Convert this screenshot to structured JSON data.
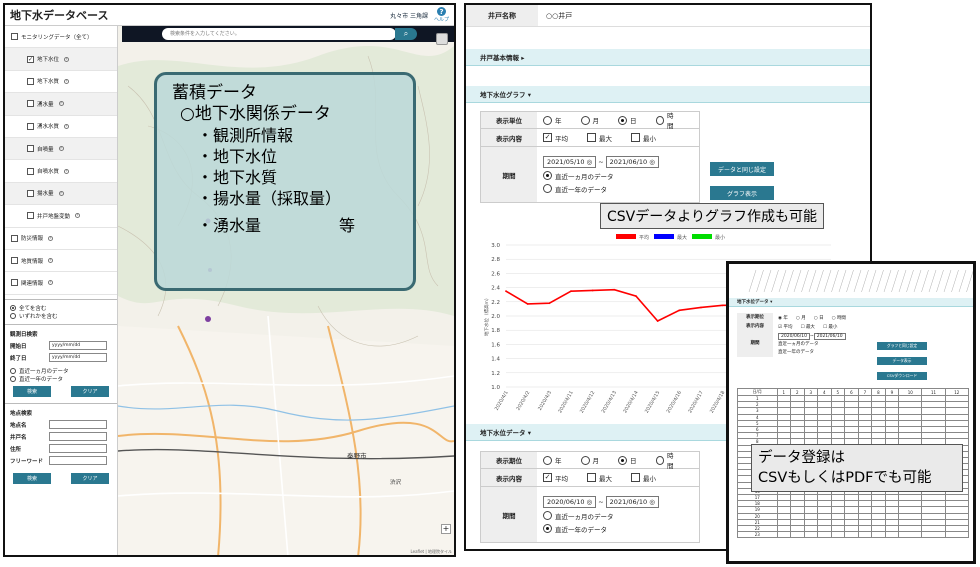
{
  "app": {
    "title": "地下水データベース",
    "department": "丸々市 三角課",
    "help_label": "ヘルプ",
    "help_glyph": "?"
  },
  "sidebar": {
    "monitoring_all": "モニタリングデータ（全て）",
    "monitoring_items": [
      {
        "label": "地下水位",
        "checked": true
      },
      {
        "label": "地下水質",
        "checked": false
      },
      {
        "label": "湧水量",
        "checked": false
      },
      {
        "label": "湧水水質",
        "checked": false
      },
      {
        "label": "自噴量",
        "checked": false
      },
      {
        "label": "自噴水質",
        "checked": false
      },
      {
        "label": "揚水量",
        "checked": false
      },
      {
        "label": "井戸地盤変動",
        "checked": false
      }
    ],
    "other_items": [
      {
        "label": "防災情報"
      },
      {
        "label": "地質情報"
      },
      {
        "label": "関連情報"
      }
    ],
    "match_all": "全てを含む",
    "match_any": "いずれかを含む",
    "obs_date": {
      "heading": "観測日検索",
      "start_label": "開始日",
      "end_label": "終了日",
      "date_placeholder": "yyyy/mm/dd",
      "recent_month": "直近一ヵ月のデータ",
      "recent_year": "直近一年のデータ",
      "search_btn": "検索",
      "clear_btn": "クリア"
    },
    "site_search": {
      "heading": "地点検索",
      "fields": [
        "地点名",
        "井戸名",
        "住所",
        "フリーワード"
      ],
      "search_btn": "検索",
      "clear_btn": "クリア"
    }
  },
  "map": {
    "search_placeholder": "検索条件を入力してください。",
    "search_icon": "magnifier-icon",
    "overlay": {
      "title": "蓄積データ",
      "subtitle": "○地下水関係データ",
      "items": [
        "・観測所情報",
        "・地下水位",
        "・地下水質",
        "・揚水量（採取量）"
      ],
      "last_item": "・湧水量",
      "last_suffix": "等"
    },
    "labels": {
      "hadano": "秦野市",
      "suginome": "渋沢",
      "attribution": "Leaflet | 地理院タイル"
    },
    "zoom_in": "+"
  },
  "well": {
    "name_label": "井戸名称",
    "name_value": "○○井戸",
    "basic_info_section": "井戸基本情報 ▸",
    "graph_section": "地下水位グラフ ▾",
    "display_unit_label": "表示単位",
    "units": [
      {
        "label": "年",
        "on": false
      },
      {
        "label": "月",
        "on": false
      },
      {
        "label": "日",
        "on": true
      },
      {
        "label": "時間",
        "on": false
      }
    ],
    "display_content_label": "表示内容",
    "contents": [
      {
        "label": "平均",
        "checked": true
      },
      {
        "label": "最大",
        "checked": false
      },
      {
        "label": "最小",
        "checked": false
      }
    ],
    "period_label": "期間",
    "graph_from": "2021/05/10",
    "graph_to": "2021/06/10",
    "recent_month": "直近一ヵ月のデータ",
    "recent_year": "直近一年のデータ",
    "same_as_data_btn": "データと同じ設定",
    "show_graph_btn": "グラフ表示",
    "data_section": "地下水位データ ▾",
    "display_interval_label": "表示期位",
    "data_from": "2020/06/10",
    "data_to": "2021/06/10",
    "callout_graph": "CSVデータよりグラフ作成も可能",
    "callout_csv_line1": "データ登録は",
    "callout_csv_line2": "CSVもしくはPDFでも可能"
  },
  "chart_data": {
    "type": "line",
    "title": "地下水位",
    "ylabel": "地下水位（標高m）",
    "ylim": [
      1.0,
      3.0
    ],
    "yticks": [
      1.0,
      1.2,
      1.4,
      1.6,
      1.8,
      2.0,
      2.2,
      2.4,
      2.6,
      2.8,
      3.0
    ],
    "legend": [
      {
        "name": "平均",
        "color": "#ff0000"
      },
      {
        "name": "最大",
        "color": "#0000ff"
      },
      {
        "name": "最小",
        "color": "#00dd00"
      }
    ],
    "x": [
      "2020/4/1",
      "2020/4/2",
      "2020/4/3",
      "2020/4/11",
      "2020/4/12",
      "2020/4/13",
      "2020/4/14",
      "2020/4/15",
      "2020/4/16",
      "2020/4/17",
      "2020/4/18",
      "2020/4/19",
      "2020/4/20",
      "2020/4/21",
      "2020/4/22",
      "2020/4/23"
    ],
    "series": [
      {
        "name": "平均",
        "color": "#ff0000",
        "values": [
          2.35,
          2.17,
          2.18,
          2.35,
          2.36,
          2.37,
          2.28,
          1.93,
          2.08,
          2.12,
          2.15,
          2.15,
          2.15,
          2.16,
          2.16,
          2.17
        ]
      }
    ]
  },
  "mini": {
    "section": "地下水位データ ▾",
    "unit_label": "表示期位",
    "units": [
      "年",
      "月",
      "日",
      "時間"
    ],
    "content_label": "表示内容",
    "contents": [
      "平均",
      "最大",
      "最小"
    ],
    "period_label": "期間",
    "from": "2020/06/10",
    "to": "2021/06/10",
    "recent_month": "直近一ヵ月のデータ",
    "recent_year": "直近一年のデータ",
    "btn_same": "グラフと同じ設定",
    "btn_show": "データ表示",
    "btn_csv": "CSVダウンロード",
    "table_corner": "日/月",
    "columns": [
      "1",
      "2",
      "3",
      "4",
      "5",
      "6",
      "7",
      "8",
      "9",
      "10",
      "11",
      "12"
    ],
    "rows": [
      "1",
      "2",
      "3",
      "4",
      "5",
      "6",
      "7",
      "8",
      "9",
      "10",
      "11",
      "12",
      "13",
      "14",
      "15",
      "16",
      "17",
      "18",
      "19",
      "20",
      "21",
      "22",
      "23"
    ]
  }
}
